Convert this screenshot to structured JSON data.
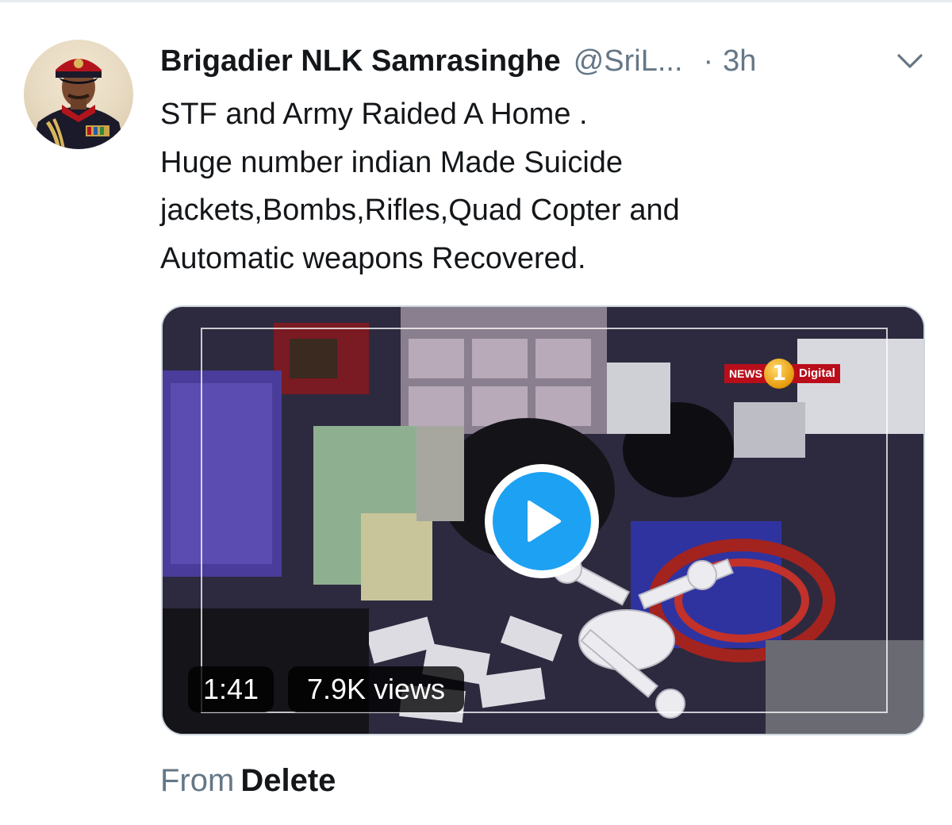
{
  "tweet": {
    "author_name": "Brigadier NLK Samrasinghe",
    "author_handle": "@SriL...",
    "separator": "·",
    "timestamp": "3h",
    "text_lines": [
      "STF and Army Raided A Home .",
      "Huge number indian Made Suicide",
      "jackets,Bombs,Rifles,Quad Copter and",
      "Automatic weapons Recovered."
    ],
    "from_label": "From",
    "source_name": "Delete"
  },
  "video": {
    "duration": "1:41",
    "views": "7.9K views",
    "watermark_logo": {
      "left": "NEWS",
      "number": "1",
      "right": "Digital"
    }
  },
  "icons": {
    "menu": "chevron-down-icon",
    "play": "play-icon"
  },
  "colors": {
    "name_text": "#14171a",
    "secondary_text": "#657786",
    "play_accent": "#1da1f2",
    "card_border": "#ccd6dd"
  }
}
